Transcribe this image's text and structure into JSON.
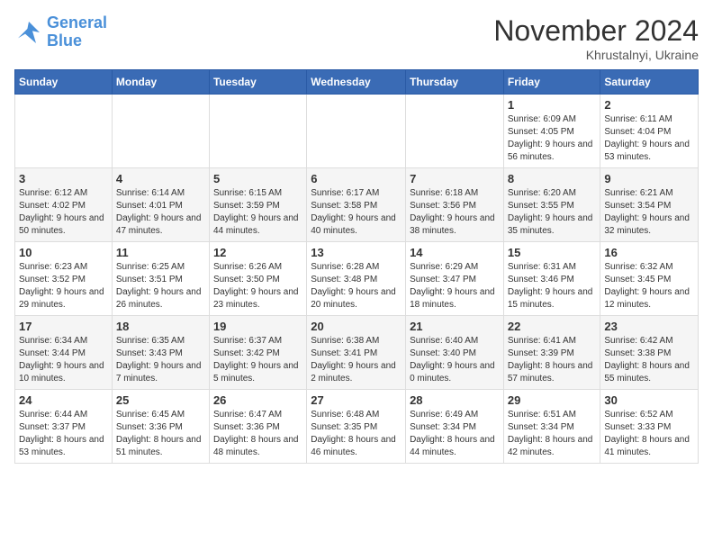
{
  "header": {
    "logo_line1": "General",
    "logo_line2": "Blue",
    "month_title": "November 2024",
    "location": "Khrustalnyi, Ukraine"
  },
  "weekdays": [
    "Sunday",
    "Monday",
    "Tuesday",
    "Wednesday",
    "Thursday",
    "Friday",
    "Saturday"
  ],
  "weeks": [
    [
      {
        "day": "",
        "info": ""
      },
      {
        "day": "",
        "info": ""
      },
      {
        "day": "",
        "info": ""
      },
      {
        "day": "",
        "info": ""
      },
      {
        "day": "",
        "info": ""
      },
      {
        "day": "1",
        "info": "Sunrise: 6:09 AM\nSunset: 4:05 PM\nDaylight: 9 hours and 56 minutes."
      },
      {
        "day": "2",
        "info": "Sunrise: 6:11 AM\nSunset: 4:04 PM\nDaylight: 9 hours and 53 minutes."
      }
    ],
    [
      {
        "day": "3",
        "info": "Sunrise: 6:12 AM\nSunset: 4:02 PM\nDaylight: 9 hours and 50 minutes."
      },
      {
        "day": "4",
        "info": "Sunrise: 6:14 AM\nSunset: 4:01 PM\nDaylight: 9 hours and 47 minutes."
      },
      {
        "day": "5",
        "info": "Sunrise: 6:15 AM\nSunset: 3:59 PM\nDaylight: 9 hours and 44 minutes."
      },
      {
        "day": "6",
        "info": "Sunrise: 6:17 AM\nSunset: 3:58 PM\nDaylight: 9 hours and 40 minutes."
      },
      {
        "day": "7",
        "info": "Sunrise: 6:18 AM\nSunset: 3:56 PM\nDaylight: 9 hours and 38 minutes."
      },
      {
        "day": "8",
        "info": "Sunrise: 6:20 AM\nSunset: 3:55 PM\nDaylight: 9 hours and 35 minutes."
      },
      {
        "day": "9",
        "info": "Sunrise: 6:21 AM\nSunset: 3:54 PM\nDaylight: 9 hours and 32 minutes."
      }
    ],
    [
      {
        "day": "10",
        "info": "Sunrise: 6:23 AM\nSunset: 3:52 PM\nDaylight: 9 hours and 29 minutes."
      },
      {
        "day": "11",
        "info": "Sunrise: 6:25 AM\nSunset: 3:51 PM\nDaylight: 9 hours and 26 minutes."
      },
      {
        "day": "12",
        "info": "Sunrise: 6:26 AM\nSunset: 3:50 PM\nDaylight: 9 hours and 23 minutes."
      },
      {
        "day": "13",
        "info": "Sunrise: 6:28 AM\nSunset: 3:48 PM\nDaylight: 9 hours and 20 minutes."
      },
      {
        "day": "14",
        "info": "Sunrise: 6:29 AM\nSunset: 3:47 PM\nDaylight: 9 hours and 18 minutes."
      },
      {
        "day": "15",
        "info": "Sunrise: 6:31 AM\nSunset: 3:46 PM\nDaylight: 9 hours and 15 minutes."
      },
      {
        "day": "16",
        "info": "Sunrise: 6:32 AM\nSunset: 3:45 PM\nDaylight: 9 hours and 12 minutes."
      }
    ],
    [
      {
        "day": "17",
        "info": "Sunrise: 6:34 AM\nSunset: 3:44 PM\nDaylight: 9 hours and 10 minutes."
      },
      {
        "day": "18",
        "info": "Sunrise: 6:35 AM\nSunset: 3:43 PM\nDaylight: 9 hours and 7 minutes."
      },
      {
        "day": "19",
        "info": "Sunrise: 6:37 AM\nSunset: 3:42 PM\nDaylight: 9 hours and 5 minutes."
      },
      {
        "day": "20",
        "info": "Sunrise: 6:38 AM\nSunset: 3:41 PM\nDaylight: 9 hours and 2 minutes."
      },
      {
        "day": "21",
        "info": "Sunrise: 6:40 AM\nSunset: 3:40 PM\nDaylight: 9 hours and 0 minutes."
      },
      {
        "day": "22",
        "info": "Sunrise: 6:41 AM\nSunset: 3:39 PM\nDaylight: 8 hours and 57 minutes."
      },
      {
        "day": "23",
        "info": "Sunrise: 6:42 AM\nSunset: 3:38 PM\nDaylight: 8 hours and 55 minutes."
      }
    ],
    [
      {
        "day": "24",
        "info": "Sunrise: 6:44 AM\nSunset: 3:37 PM\nDaylight: 8 hours and 53 minutes."
      },
      {
        "day": "25",
        "info": "Sunrise: 6:45 AM\nSunset: 3:36 PM\nDaylight: 8 hours and 51 minutes."
      },
      {
        "day": "26",
        "info": "Sunrise: 6:47 AM\nSunset: 3:36 PM\nDaylight: 8 hours and 48 minutes."
      },
      {
        "day": "27",
        "info": "Sunrise: 6:48 AM\nSunset: 3:35 PM\nDaylight: 8 hours and 46 minutes."
      },
      {
        "day": "28",
        "info": "Sunrise: 6:49 AM\nSunset: 3:34 PM\nDaylight: 8 hours and 44 minutes."
      },
      {
        "day": "29",
        "info": "Sunrise: 6:51 AM\nSunset: 3:34 PM\nDaylight: 8 hours and 42 minutes."
      },
      {
        "day": "30",
        "info": "Sunrise: 6:52 AM\nSunset: 3:33 PM\nDaylight: 8 hours and 41 minutes."
      }
    ]
  ]
}
